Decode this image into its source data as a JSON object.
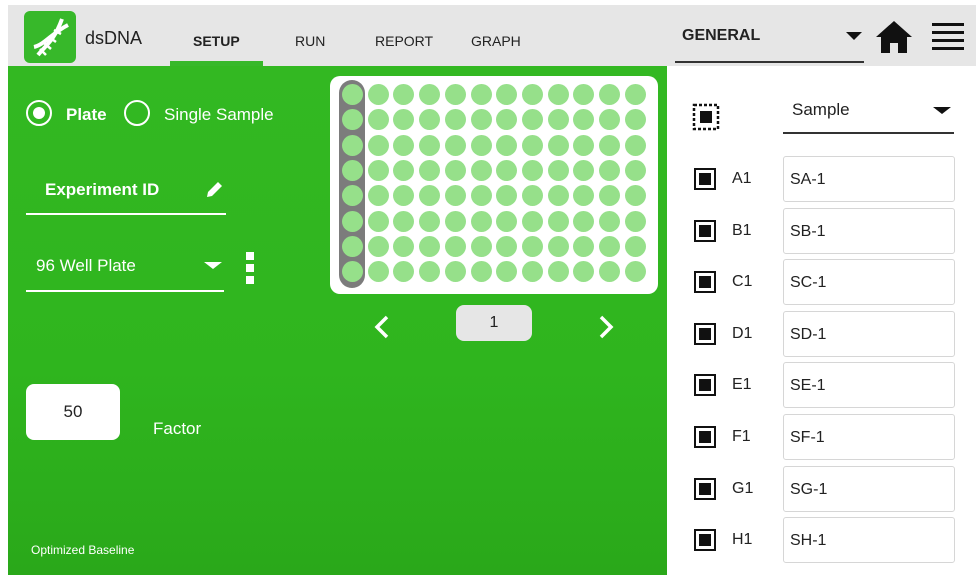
{
  "app": {
    "title": "dsDNA",
    "logo": "dna-helix-logo"
  },
  "tabs": [
    {
      "label": "SETUP",
      "active": true
    },
    {
      "label": "RUN",
      "active": false
    },
    {
      "label": "REPORT",
      "active": false
    },
    {
      "label": "GRAPH",
      "active": false
    }
  ],
  "header": {
    "general_label": "GENERAL",
    "home_icon": "home-icon",
    "menu_icon": "hamburger-menu-icon"
  },
  "mode": {
    "plate_label": "Plate",
    "single_label": "Single Sample",
    "selected": "Plate"
  },
  "experiment": {
    "id_label": "Experiment ID"
  },
  "plate_type": {
    "value": "96 Well Plate"
  },
  "factor": {
    "value": "50",
    "label": "Factor"
  },
  "baseline": {
    "label": "Optimized Baseline"
  },
  "plate_view": {
    "rows": 8,
    "columns": 12,
    "selected_column": 1,
    "page": "1"
  },
  "samples": {
    "type_label": "Sample",
    "rows": [
      {
        "well": "A1",
        "name": "SA-1",
        "checked": true
      },
      {
        "well": "B1",
        "name": "SB-1",
        "checked": true
      },
      {
        "well": "C1",
        "name": "SC-1",
        "checked": true
      },
      {
        "well": "D1",
        "name": "SD-1",
        "checked": true
      },
      {
        "well": "E1",
        "name": "SE-1",
        "checked": true
      },
      {
        "well": "F1",
        "name": "SF-1",
        "checked": true
      },
      {
        "well": "G1",
        "name": "SG-1",
        "checked": true
      },
      {
        "well": "H1",
        "name": "SH-1",
        "checked": true
      }
    ]
  },
  "colors": {
    "brand_green": "#37b82a",
    "well_green": "#96e08a",
    "selection_gray": "#7c7c7c",
    "header_gray": "#e6e6e6"
  }
}
